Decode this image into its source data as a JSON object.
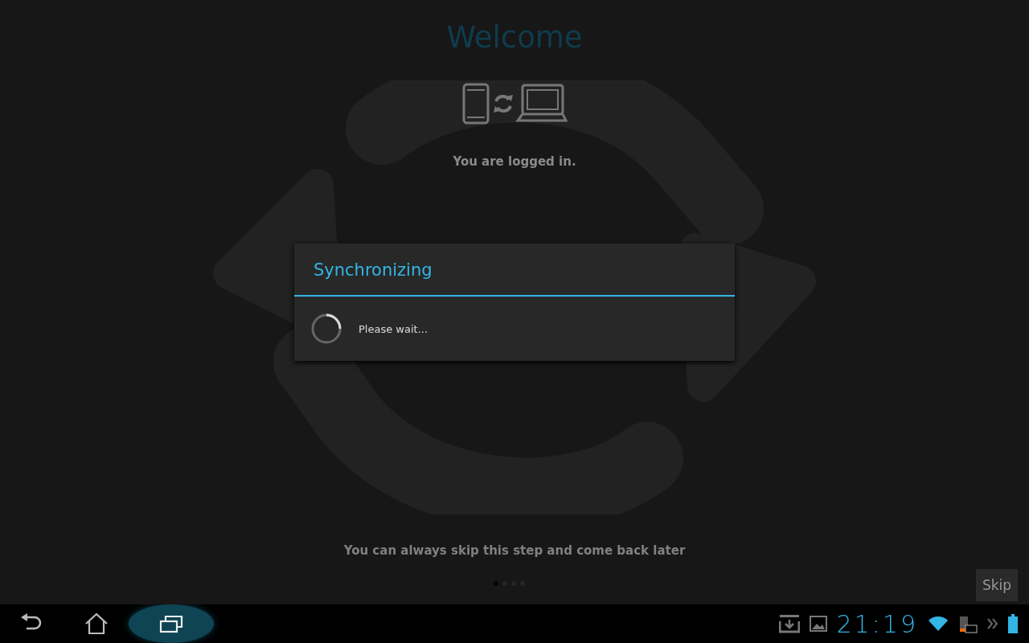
{
  "welcome": {
    "title": "Welcome",
    "status": "You are logged in."
  },
  "dialog": {
    "title": "Synchronizing",
    "message": "Please wait..."
  },
  "footer": {
    "hint": "You can always skip this step and come back later"
  },
  "page_dots": [
    {
      "selected": true
    },
    {
      "selected": false
    },
    {
      "selected": false
    },
    {
      "selected": false
    }
  ],
  "skip_button": {
    "label": "Skip"
  },
  "nav_buttons": [
    {
      "kind": "back",
      "selected": false
    },
    {
      "kind": "home",
      "selected": false
    },
    {
      "kind": "recent",
      "selected": true
    }
  ],
  "status_bar": {
    "time": "21:19"
  }
}
